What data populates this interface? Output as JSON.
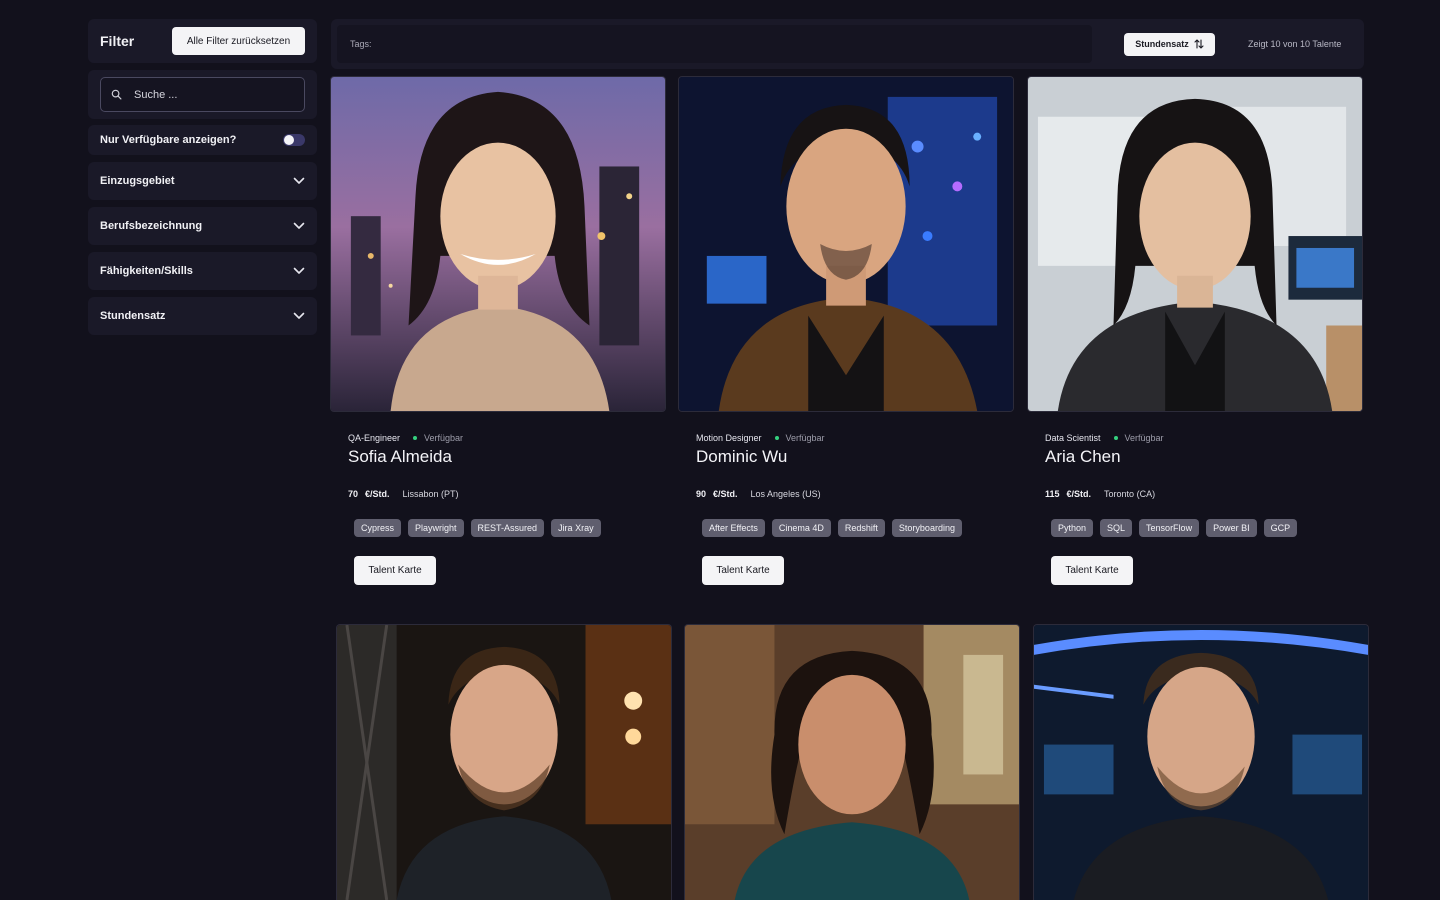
{
  "sidebar": {
    "title": "Filter",
    "reset_label": "Alle Filter zurücksetzen",
    "search_placeholder": "Suche ...",
    "available_only_label": "Nur Verfügbare anzeigen?",
    "available_only": false,
    "sections": [
      {
        "label": "Einzugsgebiet"
      },
      {
        "label": "Berufsbezeichnung"
      },
      {
        "label": "Fähigkeiten/Skills"
      },
      {
        "label": "Stundensatz"
      }
    ]
  },
  "topbar": {
    "tags_placeholder": "Tags:",
    "sort_label": "Stundensatz",
    "results_text": "Zeigt 10 von 10 Talente"
  },
  "talents": [
    {
      "role": "QA-Engineer",
      "status": "Verfügbar",
      "name": "Sofia Almeida",
      "rate": "70",
      "unit": "€/Std.",
      "location": "Lissabon (PT)",
      "skills": [
        "Cypress",
        "Playwright",
        "REST-Assured",
        "Jira Xray"
      ],
      "button": "Talent Karte"
    },
    {
      "role": "Motion Designer",
      "status": "Verfügbar",
      "name": "Dominic Wu",
      "rate": "90",
      "unit": "€/Std.",
      "location": "Los Angeles (US)",
      "skills": [
        "After Effects",
        "Cinema 4D",
        "Redshift",
        "Storyboarding"
      ],
      "button": "Talent Karte"
    },
    {
      "role": "Data Scientist",
      "status": "Verfügbar",
      "name": "Aria Chen",
      "rate": "115",
      "unit": "€/Std.",
      "location": "Toronto (CA)",
      "skills": [
        "Python",
        "SQL",
        "TensorFlow",
        "Power BI",
        "GCP"
      ],
      "button": "Talent Karte"
    }
  ],
  "colors": {
    "background": "#12111c",
    "panel": "#1a1928",
    "available_dot": "#35d07f",
    "chip": "#5f5e6e",
    "toggle_track": "#3a3869"
  },
  "icons": {
    "search": "search-icon",
    "chevron": "chevron-down-icon",
    "sort": "sort-arrows-icon"
  }
}
